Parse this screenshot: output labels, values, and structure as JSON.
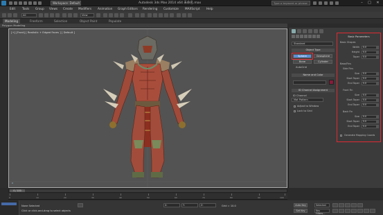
{
  "titlebar": {
    "workspace": "Workspace: Default",
    "title": "Autodesk 3ds Max 2014 x64    未命名.max",
    "search_placeholder": "Type a keyword or phrase",
    "min": "–",
    "max": "□",
    "close": "✕"
  },
  "menu": [
    "Edit",
    "Tools",
    "Group",
    "Views",
    "Create",
    "Modifiers",
    "Animation",
    "Graph Editors",
    "Rendering",
    "Customize",
    "MAXScript",
    "Help"
  ],
  "toolbar": {
    "filter": "All",
    "view": "View"
  },
  "ribbon": {
    "tabs": [
      "Modeling",
      "Freeform",
      "Selection",
      "Object Paint",
      "Populate"
    ],
    "sub": "Polygon Modeling"
  },
  "viewport": {
    "label": "[+] [Front] [ Realistic + Edged Faces ] [ Default ]",
    "axis": "x"
  },
  "command_panel": {
    "category": "Standard",
    "object_type_title": "Object Type",
    "autogrid": "AutoGrid",
    "buttons": [
      "Sphere",
      "Bone",
      "Geosphere",
      "Cylinder"
    ],
    "name_color_title": "Name and Color",
    "mapping_title": "ID Channel Assignment",
    "id_channel": "ID Channel",
    "mat_dropdown": "Mat Pattern",
    "adjust_window": "Adjust to Window",
    "lock_to_grid": "Lock to Grid"
  },
  "params": {
    "title": "Basic Parameters",
    "group_basic": "Basic Shapes",
    "basic_rows": [
      {
        "label": "Width",
        "value": "0.0"
      },
      {
        "label": "Height",
        "value": "0.0"
      },
      {
        "label": "Taper",
        "value": "0.0"
      }
    ],
    "group_base": "Base/Fins",
    "side_fins": "Side Fins",
    "side_rows": [
      {
        "label": "Size",
        "value": "0.0"
      },
      {
        "label": "Start Taper",
        "value": "0.0"
      },
      {
        "label": "End Taper",
        "value": "0.0"
      }
    ],
    "front_fin": "Front Fin",
    "front_rows": [
      {
        "label": "Size",
        "value": "0.0"
      },
      {
        "label": "Start Taper",
        "value": "0.0"
      },
      {
        "label": "End Taper",
        "value": "0.0"
      }
    ],
    "back_fin": "Back Fin",
    "back_rows": [
      {
        "label": "Size",
        "value": "0.0"
      },
      {
        "label": "Start Taper",
        "value": "0.0"
      },
      {
        "label": "End Taper",
        "value": "0.0"
      }
    ],
    "footer": "Generate Mapping Coords"
  },
  "timeline": {
    "frame": "0 / 100",
    "ticks": [
      "0",
      "10",
      "20",
      "30",
      "40",
      "50",
      "60",
      "70",
      "80",
      "90",
      "100"
    ]
  },
  "status": {
    "line1": "None Selected",
    "line2": "Click or click-and-drag to select objects",
    "x": "X:",
    "y": "Y:",
    "z": "Z:",
    "grid": "Grid = 10.0",
    "autokey": "Auto Key",
    "selected": "Selected",
    "setkey": "Set Key",
    "keyfilters": "Key Filters..."
  },
  "colors": {
    "accent_red": "#e02a33",
    "active_blue": "#5b8fd6",
    "swatch": "#8a1a3a"
  }
}
